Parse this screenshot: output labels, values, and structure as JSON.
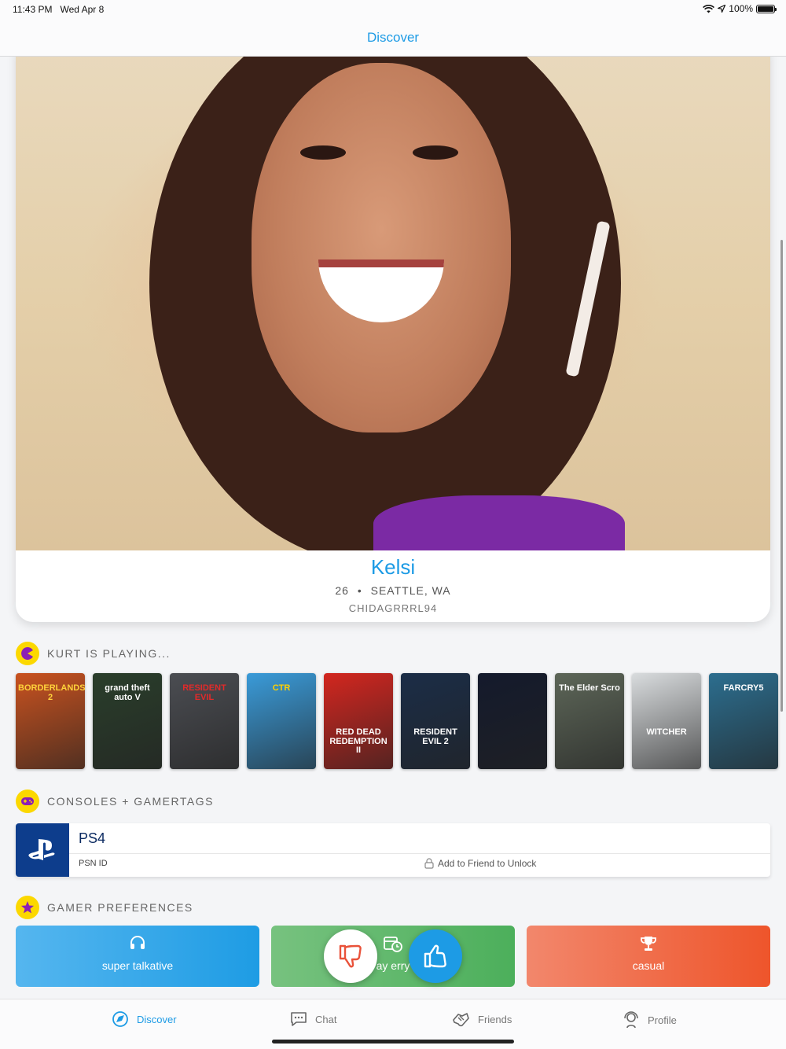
{
  "status_bar": {
    "time": "11:43 PM",
    "date": "Wed Apr 8",
    "battery": "100%"
  },
  "nav": {
    "title": "Discover"
  },
  "profile": {
    "name": "Kelsi",
    "age": "26",
    "separator": "•",
    "location": "SEATTLE, WA",
    "gamertag": "CHIDAGRRRL94"
  },
  "sections": {
    "playing": "KURT IS PLAYING...",
    "consoles": "CONSOLES + GAMERTAGS",
    "preferences": "GAMER PREFERENCES"
  },
  "games": [
    {
      "title": "BORDERLANDS 2",
      "bg": "#c9521f",
      "fg": "#ffd23a"
    },
    {
      "title": "grand theft auto V",
      "bg": "#2a3e2b",
      "fg": "#ffffff"
    },
    {
      "title": "RESIDENT EVIL",
      "bg": "#4b4d52",
      "fg": "#e22a2a"
    },
    {
      "title": "CTR",
      "bg": "#3a9bd9",
      "fg": "#ffd000"
    },
    {
      "title": "RED DEAD REDEMPTION II",
      "bg": "#d3261f",
      "fg": "#ffffff"
    },
    {
      "title": "RESIDENT EVIL 2",
      "bg": "#1b2d47",
      "fg": "#ffffff"
    },
    {
      "title": "",
      "bg": "#141a2c",
      "fg": "#ffffff"
    },
    {
      "title": "The Elder Scro",
      "bg": "#5d6658",
      "fg": "#ffffff"
    },
    {
      "title": "WITCHER",
      "bg": "#d9dcde",
      "fg": "#ffffff"
    },
    {
      "title": "FARCRY5",
      "bg": "#2c6e8f",
      "fg": "#ffffff"
    }
  ],
  "console": {
    "name": "PS4",
    "id_label": "PSN ID",
    "lock_text": "Add to Friend to Unlock"
  },
  "preferences": [
    {
      "label": "super talkative",
      "icon": "headphones-icon",
      "color_from": "#55b6ef",
      "color_to": "#1e9ce4"
    },
    {
      "label": "ay erry",
      "icon": "calendar-clock-icon",
      "color_from": "#77c27f",
      "color_to": "#4caf5b"
    },
    {
      "label": "casual",
      "icon": "trophy-icon",
      "color_from": "#f2876c",
      "color_to": "#ee552b"
    }
  ],
  "tabs": [
    {
      "label": "Discover",
      "icon": "discover-icon",
      "active": true
    },
    {
      "label": "Chat",
      "icon": "chat-icon",
      "active": false
    },
    {
      "label": "Friends",
      "icon": "friends-icon",
      "active": false
    },
    {
      "label": "Profile",
      "icon": "profile-icon",
      "active": false
    }
  ],
  "colors": {
    "accent": "#1d9be5",
    "badge": "#fcd800",
    "dislike": "#e9523a",
    "like": "#1d9be5"
  }
}
